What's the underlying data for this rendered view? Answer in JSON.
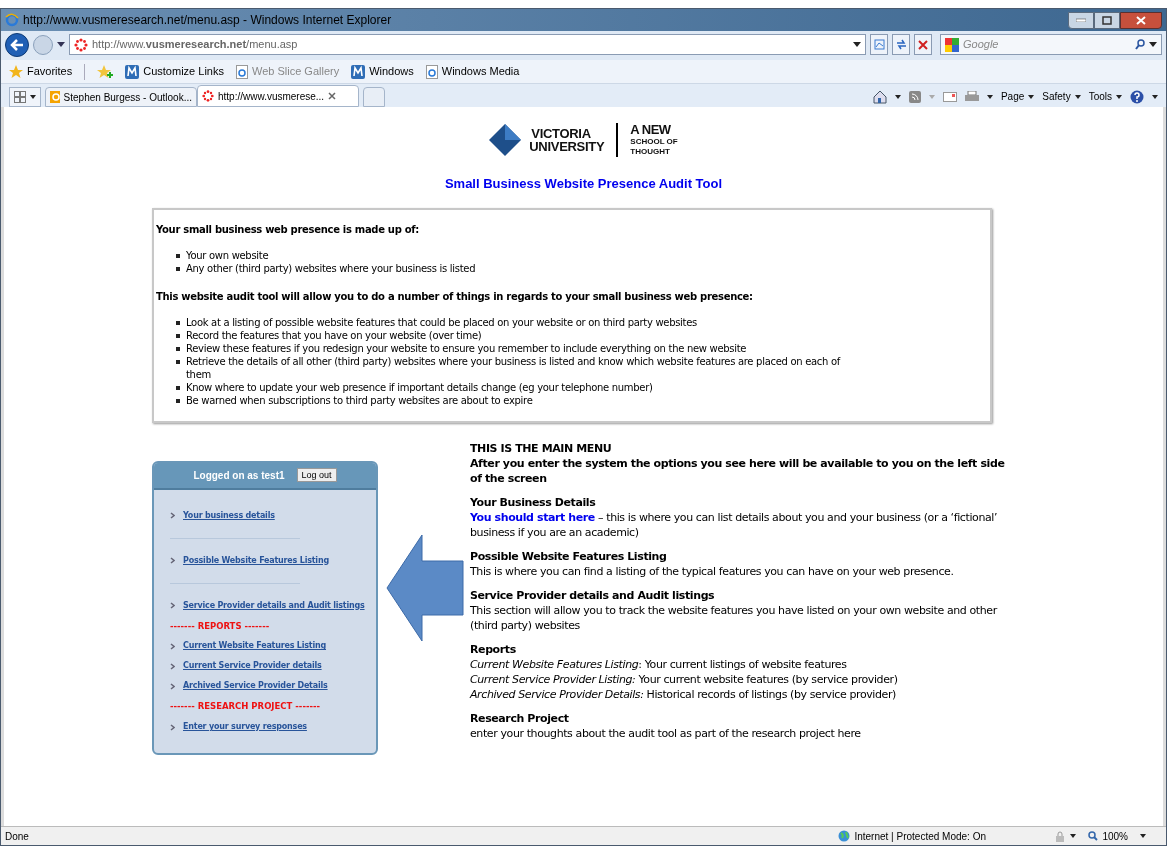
{
  "window": {
    "title": "http://www.vusmeresearch.net/menu.asp - Windows Internet Explorer"
  },
  "address_bar": {
    "url": "http://www.**vusmeresearch.net**/menu.asp"
  },
  "search": {
    "placeholder": "Google"
  },
  "favorites_bar": [
    {
      "label": "Favorites",
      "kind": "star",
      "disabled": false
    },
    {
      "label": "Customize Links",
      "kind": "m",
      "disabled": false
    },
    {
      "label": "Web Slice Gallery",
      "kind": "ie",
      "disabled": true
    },
    {
      "label": "Windows",
      "kind": "m",
      "disabled": false
    },
    {
      "label": "Windows Media",
      "kind": "ie",
      "disabled": false
    }
  ],
  "tabs": [
    {
      "label": "Stephen Burgess - Outlook...",
      "selected": false
    },
    {
      "label": "http://www.vusmerese...",
      "selected": true
    }
  ],
  "command_bar": [
    "Page",
    "Safety",
    "Tools"
  ],
  "page": {
    "logo": {
      "name_line_1": "VICTORIA",
      "name_line_2": "UNIVERSITY",
      "tagline_1": "A NEW",
      "tagline_2": "SCHOOL OF",
      "tagline_3": "THOUGHT"
    },
    "heading": "Small Business Website Presence Audit Tool",
    "intro": [
      {
        "title": "Your small business web presence is made up of:",
        "bullets": [
          "Your own website",
          "Any other (third party) websites where your business is listed"
        ]
      },
      {
        "title": "This website audit tool will allow you to do a number of things in regards to your small business web presence:",
        "bullets": [
          "Look at a listing of possible website features that could be placed on your website or on third party websites",
          "Record the features that you have on your website (over time)",
          "Review these features if you redesign your website to ensure you remember to include everything on the new website",
          "Retrieve the details of all other (third party) websites where your business is listed and know which website features are placed on each of them",
          "Know where to update your web presence if important details change (eg your telephone number)",
          "Be warned when subscriptions to third party websites are about to expire"
        ]
      }
    ],
    "menu_panel": {
      "logged_on": "Logged on as test1",
      "logout": "Log out",
      "items": [
        {
          "kind": "link",
          "label": "Your business details"
        },
        {
          "kind": "divider"
        },
        {
          "kind": "link",
          "label": "Possible Website Features Listing"
        },
        {
          "kind": "divider"
        },
        {
          "kind": "link",
          "label": "Service Provider details and Audit listings"
        },
        {
          "kind": "section",
          "label": "------- REPORTS -------"
        },
        {
          "kind": "link",
          "label": "Current Website Features Listing"
        },
        {
          "kind": "link",
          "label": "Current Service Provider details"
        },
        {
          "kind": "link",
          "label": "Archived Service Provider Details"
        },
        {
          "kind": "section",
          "label": "------- RESEARCH PROJECT -------"
        },
        {
          "kind": "link",
          "label": "Enter your survey responses"
        }
      ]
    },
    "description": {
      "title": "THIS IS THE MAIN MENU",
      "subtitle": "After you enter the system the options you see here will be available to you on the left side of the screen",
      "sections": [
        {
          "heading": "Your Business Details",
          "link": "You should start here",
          "lines": [
            "– this is where you can list details about you and your business (or a ‘fictional’ business if you are an academic)"
          ]
        },
        {
          "heading": "Possible Website Features Listing",
          "lines": [
            "This is where you can find a listing of the typical features you can have on your web presence."
          ]
        },
        {
          "heading": "Service Provider details and Audit listings",
          "lines": [
            "This section will allow you to track the website features you have listed on your own website and other (third party) websites"
          ]
        },
        {
          "heading": "Reports",
          "lines": [
            "*Current Website Features Listing*:  Your current listings of website features",
            "*Current Service Provider Listing:*   Your current website features (by service provider)",
            "*Archived Service Provider Details:* Historical records of listings (by service provider)"
          ]
        },
        {
          "heading": "Research Project",
          "lines": [
            "enter your thoughts about the audit tool as part of the research project here"
          ]
        }
      ]
    }
  },
  "status_bar": {
    "text": "Done",
    "zone": "Internet | Protected Mode: On",
    "zoom": "100%"
  }
}
